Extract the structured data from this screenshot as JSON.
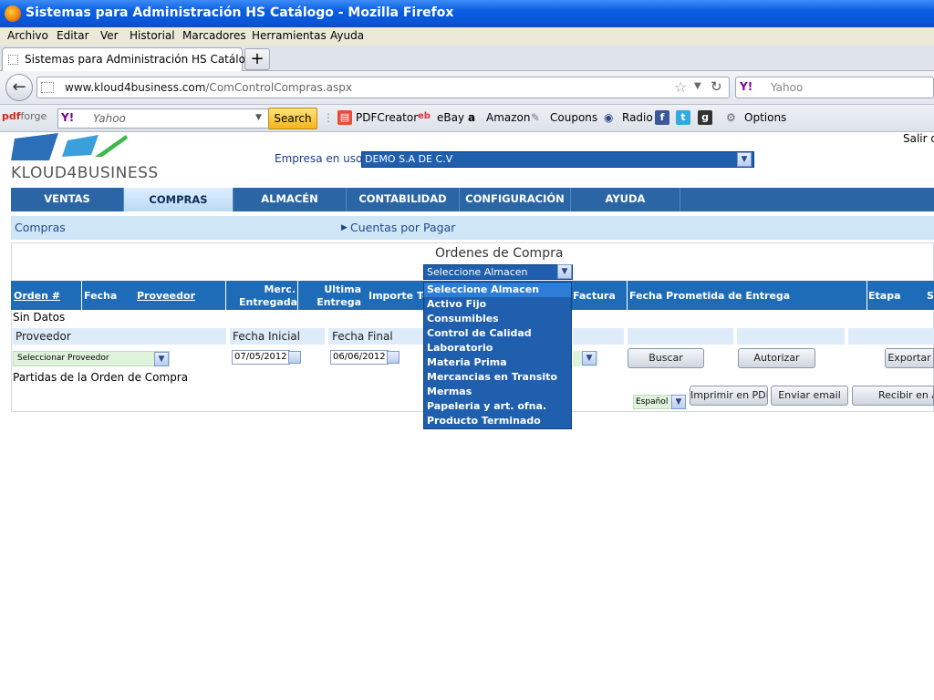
{
  "window": {
    "title": "Sistemas para Administración HS Catálogo - Mozilla Firefox"
  },
  "menu": [
    "Archivo",
    "Editar",
    "Ver",
    "Historial",
    "Marcadores",
    "Herramientas",
    "Ayuda"
  ],
  "tab": {
    "title": "Sistemas para Administración HS Catálogo",
    "new_tab": "+"
  },
  "address": {
    "host": "www.kloud4business.com",
    "path": "/ComControlCompras.aspx",
    "search_placeholder": "Yahoo",
    "yahoo_badge": "Y!"
  },
  "toolbar": {
    "pdfforge_a": "pdf",
    "pdfforge_b": "forge",
    "yahoo_badge": "Y!",
    "yahoo_placeholder": "Yahoo",
    "search_label": "Search",
    "pdfcreator": "PDFCreator",
    "ebay": "eBay",
    "amazon": "Amazon",
    "coupons": "Coupons",
    "radio": "Radio",
    "options": "Options"
  },
  "header": {
    "logo_text": "KLOUD4BUSINESS",
    "salir": "Salir d",
    "empresa_label": "Empresa en uso:",
    "empresa_value": "DEMO S.A DE C.V"
  },
  "nav": {
    "items": [
      "VENTAS",
      "COMPRAS",
      "ALMACÉN",
      "CONTABILIDAD",
      "CONFIGURACIÓN",
      "AYUDA"
    ],
    "active": "COMPRAS"
  },
  "subnav": {
    "left": "Compras",
    "right": "Cuentas por Pagar"
  },
  "ordenes": {
    "title": "Ordenes de Compra",
    "almacen_selected": "Seleccione Almacen",
    "almacen_options": [
      "Seleccione Almacen",
      "Activo Fijo",
      "Consumibles",
      "Control de Calidad",
      "Laboratorio",
      "Materia Prima",
      "Mercancias en Transito",
      "Mermas",
      "Papeleria y art. ofna.",
      "Producto Terminado"
    ]
  },
  "grid": {
    "orden": "Orden #",
    "fecha": "Fecha",
    "proveedor": "Proveedor",
    "merc_1": "Merc.",
    "merc_2": "Entregada",
    "ultima_1": "Ultima",
    "ultima_2": "Entrega",
    "importe": "Importe Tot",
    "factura": "Factura",
    "fecha_prometida": "Fecha Prometida de Entrega",
    "etapa": "Etapa",
    "s": "S",
    "empty": "Sin Datos"
  },
  "filters": {
    "proveedor_label": "Proveedor",
    "fecha_inicial_label": "Fecha Inicial",
    "fecha_final_label": "Fecha Final",
    "proveedor_select": "Seleccionar Proveedor",
    "fecha_inicial": "07/05/2012",
    "fecha_final": "06/06/2012"
  },
  "buttons": {
    "buscar": "Buscar",
    "autorizar": "Autorizar",
    "exportar": "Exportar",
    "imprimir_pdf": "Imprimir en PDF",
    "enviar_email": "Enviar email",
    "recibir": "Recibir en Alm"
  },
  "partidas": "Partidas de la Orden de Compra",
  "idioma": "Español"
}
